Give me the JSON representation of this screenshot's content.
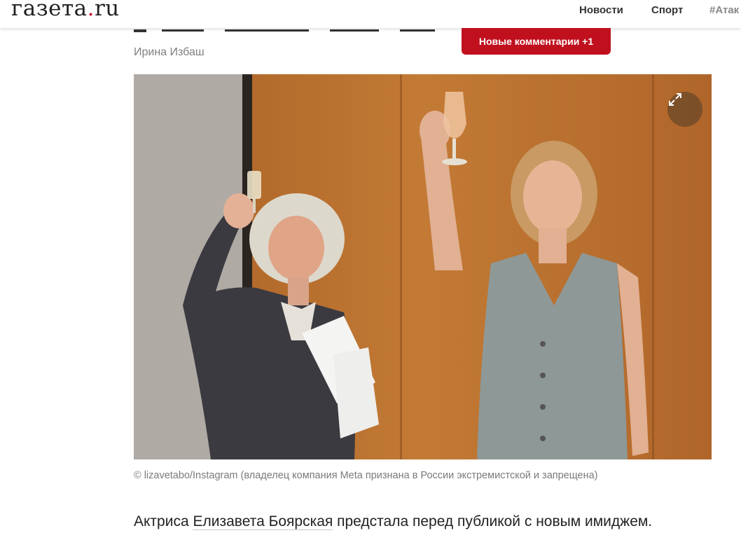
{
  "header": {
    "logo_main": "газета",
    "logo_dot": ".",
    "logo_tld": "ru",
    "nav": [
      "Новости",
      "Спорт",
      "#Атак"
    ]
  },
  "article": {
    "author": "Ирина Избаш",
    "new_comments_label": "Новые комментарии +1",
    "photo_caption": "©  lizavetabo/Instagram (владелец компания Meta признана в России экстремистской и запрещена)",
    "lead_prefix": "Актриса ",
    "lead_link": "Елизавета Боярская",
    "lead_suffix": " предстала перед публикой с новым имиджем."
  },
  "icons": {
    "expand": "expand-arrows-icon"
  },
  "colors": {
    "brand_red": "#c0101e",
    "logo_dot": "#c8102e"
  }
}
